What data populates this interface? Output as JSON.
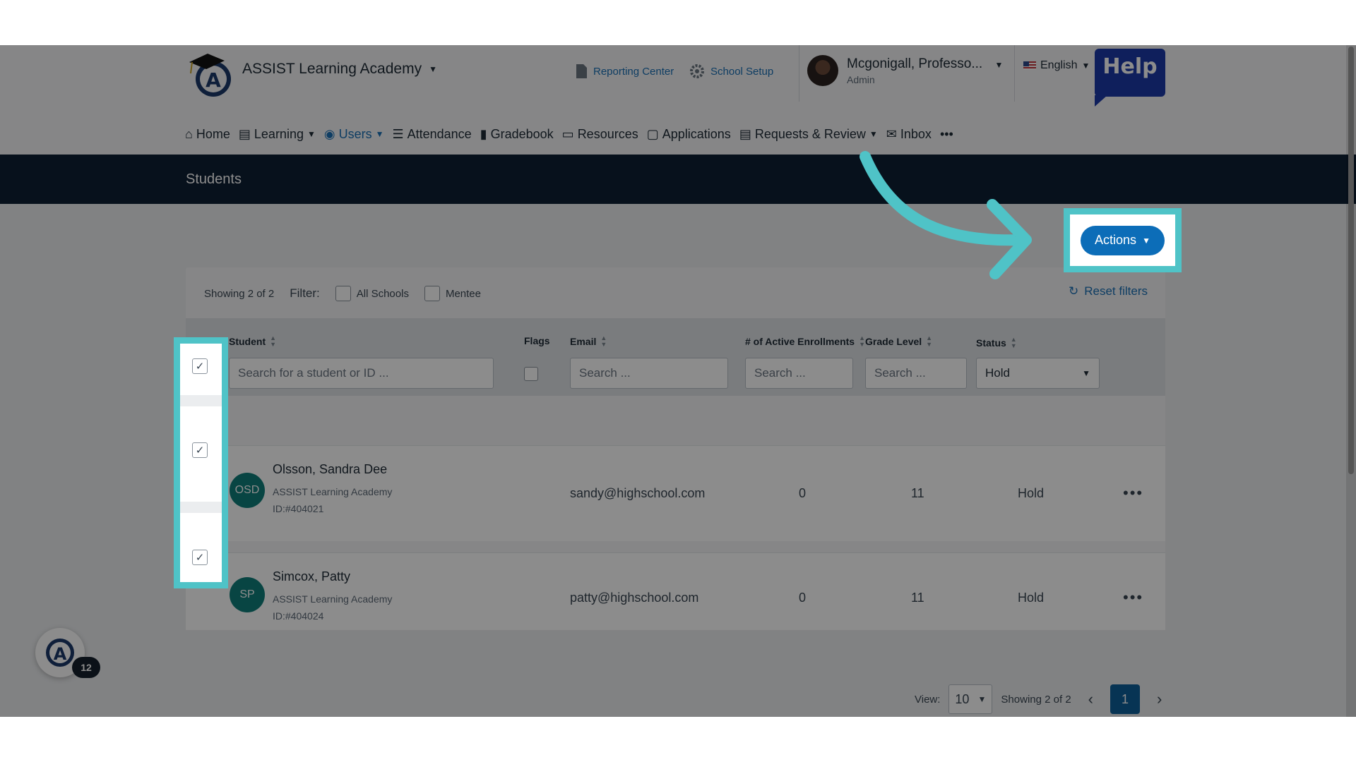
{
  "header": {
    "brand": "ASSIST Learning Academy",
    "reporting_center": "Reporting Center",
    "school_setup": "School Setup",
    "user_name": "Mcgonigall, Professo...",
    "user_role": "Admin",
    "language": "English",
    "help": "Help"
  },
  "nav": {
    "items": [
      {
        "label": "Home",
        "icon": "home-icon"
      },
      {
        "label": "Learning",
        "icon": "book-icon"
      },
      {
        "label": "Users",
        "icon": "user-circle-icon"
      },
      {
        "label": "Attendance",
        "icon": "attendance-icon"
      },
      {
        "label": "Gradebook",
        "icon": "gradebook-icon"
      },
      {
        "label": "Resources",
        "icon": "resources-icon"
      },
      {
        "label": "Applications",
        "icon": "applications-icon"
      },
      {
        "label": "Requests & Review",
        "icon": "requests-icon"
      },
      {
        "label": "Inbox",
        "icon": "mail-icon"
      }
    ],
    "more": "•••",
    "active": "Users"
  },
  "page": {
    "title": "Students",
    "actions_label": "Actions"
  },
  "filters": {
    "showing": "Showing 2 of 2",
    "filter_label": "Filter:",
    "all_schools": "All Schools",
    "mentee": "Mentee",
    "reset": "Reset filters"
  },
  "table": {
    "columns": {
      "student": "Student",
      "flags": "Flags",
      "email": "Email",
      "enrollments": "# of Active Enrollments",
      "grade": "Grade Level",
      "status": "Status"
    },
    "placeholders": {
      "student": "Search for a student or ID ...",
      "email": "Search ...",
      "enrollments": "Search ...",
      "grade": "Search ..."
    },
    "status_selected": "Hold",
    "rows": [
      {
        "initials": "OSD",
        "name": "Olsson, Sandra Dee",
        "school": "ASSIST Learning Academy",
        "id": "ID:#404021",
        "email": "sandy@highschool.com",
        "enrollments": "0",
        "grade": "11",
        "status": "Hold"
      },
      {
        "initials": "SP",
        "name": "Simcox, Patty",
        "school": "ASSIST Learning Academy",
        "id": "ID:#404024",
        "email": "patty@highschool.com",
        "enrollments": "0",
        "grade": "11",
        "status": "Hold"
      }
    ]
  },
  "pagination": {
    "view_label": "View:",
    "per_page": "10",
    "showing": "Showing 2 of 2",
    "current_page": "1"
  },
  "widget": {
    "badge": "12"
  },
  "colors": {
    "accent": "#1a6fb5",
    "highlight": "#4fc3c7",
    "titlebar": "#0e1f33",
    "avatar": "#0f7f7a"
  }
}
